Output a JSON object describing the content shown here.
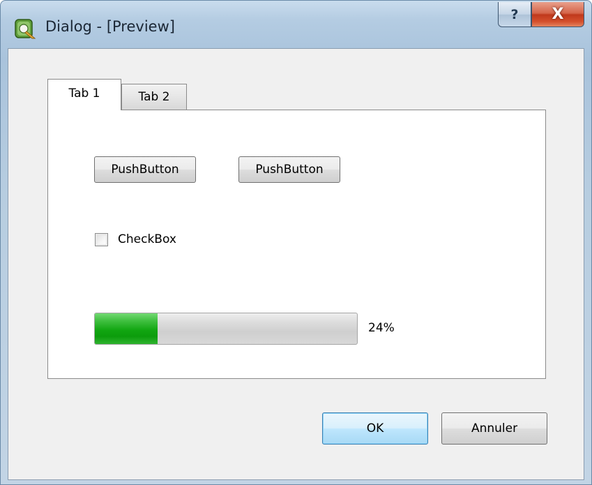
{
  "window": {
    "title": "Dialog - [Preview]",
    "icon": "qt-designer-app-icon",
    "help_label": "?",
    "close_label": "X",
    "accent_color": "#c0391c"
  },
  "tabs": [
    {
      "label": "Tab 1",
      "selected": true
    },
    {
      "label": "Tab 2",
      "selected": false
    }
  ],
  "tab1": {
    "push_button_1": "PushButton",
    "push_button_2": "PushButton",
    "checkbox": {
      "label": "CheckBox",
      "checked": false
    },
    "progress": {
      "value": 24,
      "text": "24%",
      "fill_color": "#11a611"
    }
  },
  "footer": {
    "ok_label": "OK",
    "cancel_label": "Annuler"
  }
}
